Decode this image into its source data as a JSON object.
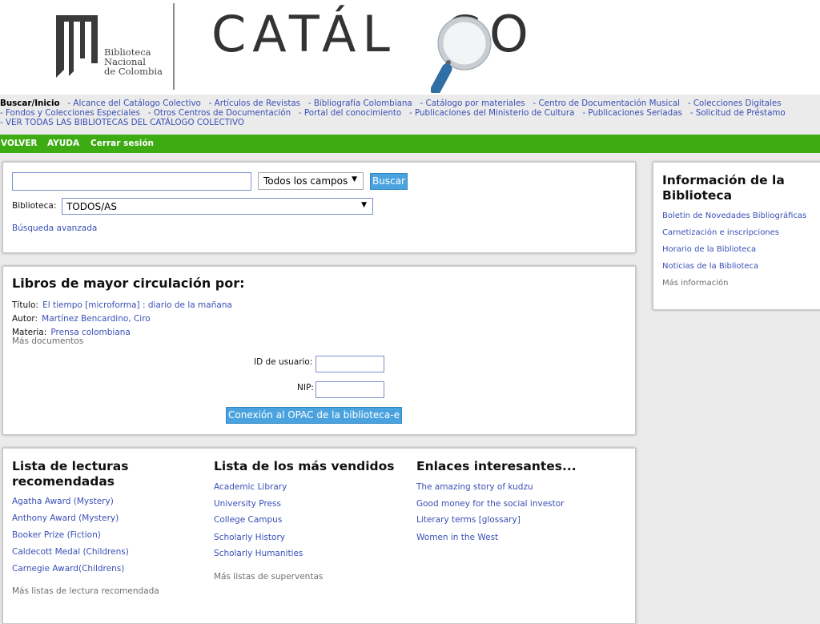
{
  "header": {
    "logo_line1": "Biblioteca",
    "logo_line2": "Nacional",
    "logo_line3": "de Colombia",
    "title_left": "CATÁL",
    "title_right": "GO"
  },
  "topnav": {
    "current": "Buscar/Inicio",
    "row1": [
      "- Alcance del Catálogo Colectivo",
      "- Artículos de Revistas",
      "- Bibliografía Colombiana",
      "- Catálogo por materiales",
      "- Centro de Documentación Musical",
      "- Colecciones Digitales"
    ],
    "row2": [
      "- Fondos y Colecciones Especiales",
      "- Otros Centros de Documentación",
      "- Portal del conocimiento",
      "- Publicaciones del Ministerio de Cultura",
      "- Publicaciones Seriadas",
      "- Solicitud de Préstamo"
    ],
    "row3": [
      "- VER TODAS LAS BIBLIOTECAS DEL CATÁLOGO COLECTIVO"
    ]
  },
  "greenbar": {
    "volver": "VOLVER",
    "ayuda": "AYUDA",
    "cerrar": "Cerrar sesión"
  },
  "search": {
    "query_value": "",
    "field_select": "Todos los campos",
    "button": "Buscar",
    "library_label": "Biblioteca:",
    "library_select": "TODOS/AS",
    "advanced": "Búsqueda avanzada"
  },
  "circulation": {
    "heading": "Libros de mayor circulación por:",
    "title_label": "Título:",
    "title_value": "El tiempo [microforma] : diario de la mañana",
    "author_label": "Autor:",
    "author_value": "Martínez Bencardino, Ciro",
    "subject_label": "Materia:",
    "subject_value": "Prensa colombiana",
    "more": "Más documentos",
    "user_id_label": "ID de usuario:",
    "pin_label": "NIP:",
    "login_button": "Conexión al OPAC de la biblioteca-e"
  },
  "info": {
    "heading": "Información de la Biblioteca",
    "links": [
      "Boletin de Novedades Bibliográficas",
      "Carnetización e inscripciones",
      "Horario de la Biblioteca",
      "Noticias de la Biblioteca"
    ],
    "more": "Más información"
  },
  "lists": {
    "reading": {
      "heading": "Lista de lecturas recomendadas",
      "items": [
        "Agatha Award (Mystery)",
        "Anthony Award (Mystery)",
        "Booker Prize (Fiction)",
        "Caldecott Medal (Childrens)",
        "Carnegie Award(Childrens)"
      ],
      "more": "Más listas de lectura recomendada"
    },
    "bestsellers": {
      "heading": "Lista de los más vendidos",
      "items": [
        "Academic Library",
        "University Press",
        "College Campus",
        "Scholarly History",
        "Scholarly Humanities"
      ],
      "more": "Más listas de superventas"
    },
    "links": {
      "heading": "Enlaces interesantes...",
      "items": [
        "The amazing story of kudzu",
        "Good money for the social investor",
        "Literary terms [glossary]",
        "Women in the West"
      ]
    }
  },
  "colors": {
    "link": "#3a4fb5",
    "green_bar": "#3dab12",
    "button": "#4aa3df"
  },
  "icons": {
    "magnifier": "magnifier-icon",
    "dropdown": "dropdown-arrow-icon",
    "logo": "library-logo-icon"
  }
}
